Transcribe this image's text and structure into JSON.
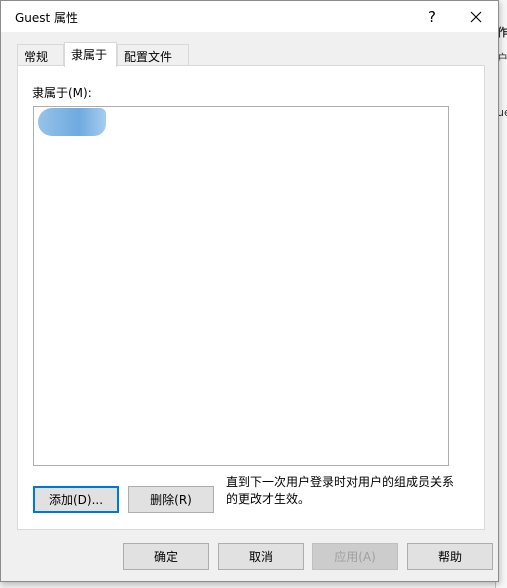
{
  "window": {
    "title": "Guest 属性",
    "help_glyph": "?"
  },
  "tabs": [
    {
      "label": "常规"
    },
    {
      "label": "隶属于"
    },
    {
      "label": "配置文件"
    }
  ],
  "member_of": {
    "label": "隶属于(M):",
    "add_label": "添加(D)...",
    "remove_label": "删除(R)",
    "note": "直到下一次用户登录时对用户的组成员关系的更改才生效。"
  },
  "footer": {
    "ok_label": "确定",
    "cancel_label": "取消",
    "apply_label": "应用(A)",
    "help_label": "帮助"
  },
  "background": {
    "fragment_1": "作",
    "fragment_2": "户",
    "fragment_3": "ue"
  },
  "colors": {
    "accent": "#0078d7",
    "selection": "#5fa0dc"
  }
}
